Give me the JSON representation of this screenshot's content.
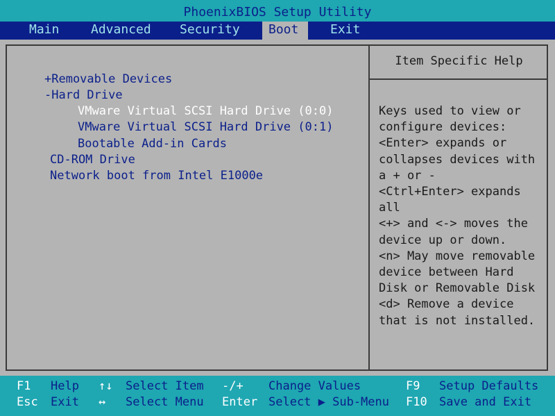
{
  "title": "PhoenixBIOS Setup Utility",
  "menu": [
    {
      "label": "Main",
      "active": false
    },
    {
      "label": "Advanced",
      "active": false
    },
    {
      "label": "Security",
      "active": false
    },
    {
      "label": "Boot",
      "active": true
    },
    {
      "label": "Exit",
      "active": false
    }
  ],
  "boot_order": [
    {
      "label": "+Removable Devices",
      "selected": false
    },
    {
      "label": "-Hard Drive",
      "selected": false
    },
    {
      "label": "VMware Virtual SCSI Hard Drive (0:0)",
      "selected": true
    },
    {
      "label": "VMware Virtual SCSI Hard Drive (0:1)",
      "selected": false
    },
    {
      "label": "Bootable Add-in Cards",
      "selected": false
    },
    {
      "label": "CD-ROM Drive",
      "selected": false
    },
    {
      "label": "Network boot from Intel E1000e",
      "selected": false
    }
  ],
  "help": {
    "title": "Item Specific Help",
    "text": "Keys used to view or\nconfigure devices:\n<Enter> expands or\ncollapses devices with\na + or -\n<Ctrl+Enter> expands\nall\n<+> and <-> moves the\ndevice up or down.\n<n> May move removable\ndevice between Hard\nDisk or Removable Disk\n<d> Remove a device\nthat is not installed."
  },
  "footer": {
    "row1": [
      {
        "key": "F1",
        "desc": "Help"
      },
      {
        "key": "↑↓",
        "desc": "Select Item"
      },
      {
        "key": "-/+",
        "desc": "Change Values"
      },
      {
        "key": "F9",
        "desc": "Setup Defaults"
      }
    ],
    "row2": [
      {
        "key": "Esc",
        "desc": "Exit"
      },
      {
        "key": "↔",
        "desc": "Select Menu"
      },
      {
        "key": "Enter",
        "desc": "Select ▶ Sub-Menu"
      },
      {
        "key": "F10",
        "desc": "Save and Exit"
      }
    ]
  },
  "colors": {
    "teal": "#1fa7b2",
    "navy": "#0b1f8a",
    "gray": "#b4b4b4",
    "selected": "#ffffff"
  }
}
